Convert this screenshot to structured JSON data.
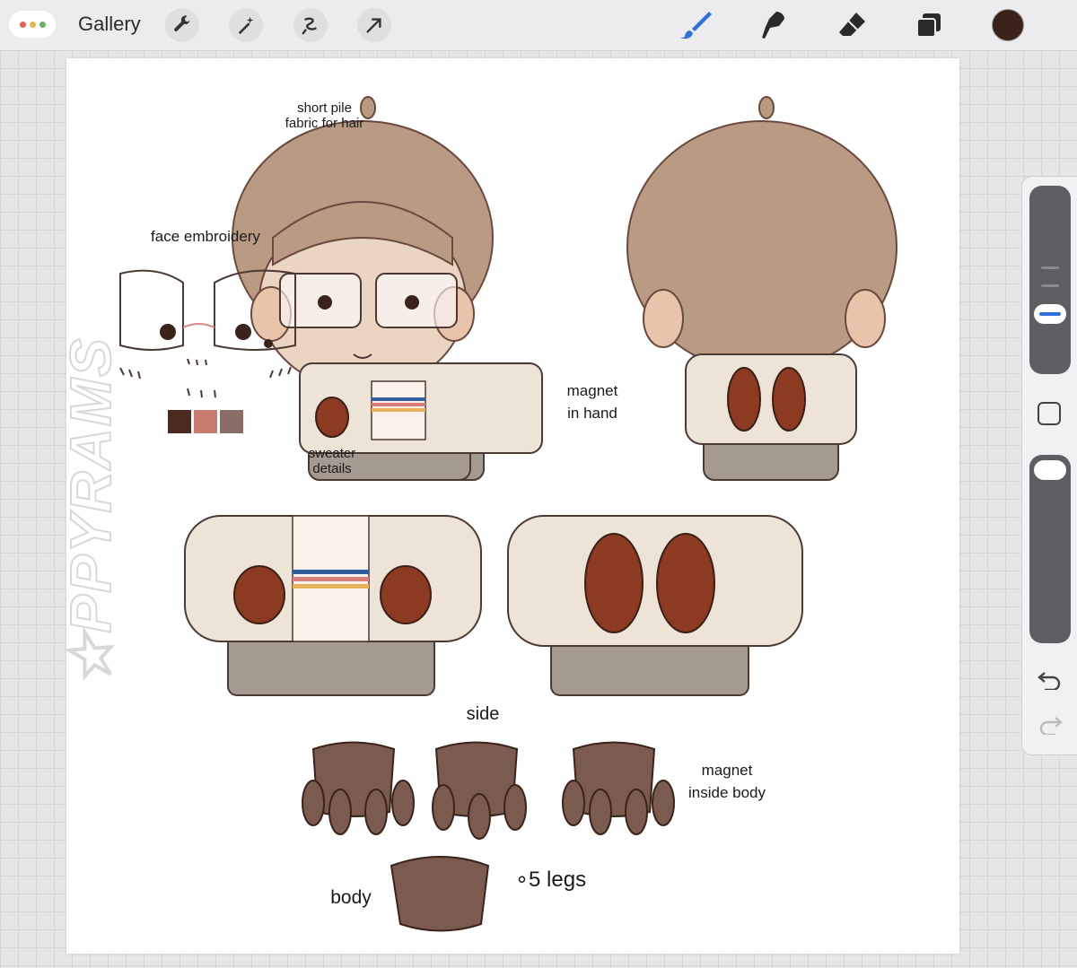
{
  "toolbar": {
    "gallery_label": "Gallery",
    "left_tools": [
      "wrench-icon",
      "magic-wand-icon",
      "selection-icon",
      "transform-arrow-icon"
    ],
    "right_tools": [
      "brush-icon",
      "smudge-icon",
      "eraser-icon",
      "layers-icon"
    ],
    "active_tool": "brush-icon",
    "current_color": "#3a231b",
    "accent": "#2f6fdc"
  },
  "window_dots": [
    "#e0605a",
    "#e5b949",
    "#6ab35f"
  ],
  "canvas": {
    "labels": {
      "short_pile": "short pile\nfabric for hair",
      "face_embroidery": "face embroidery",
      "sweater_details": "sweater\ndetails",
      "magnet_in_hand": "magnet\nin hand",
      "side": "side",
      "magnet_inside_body": "magnet\ninside body",
      "body": "body",
      "legs": "∘5 legs"
    },
    "palette": [
      "#4b2a22",
      "#c77a6e",
      "#8a6e66"
    ],
    "watermark": "★PPYRAMS"
  }
}
